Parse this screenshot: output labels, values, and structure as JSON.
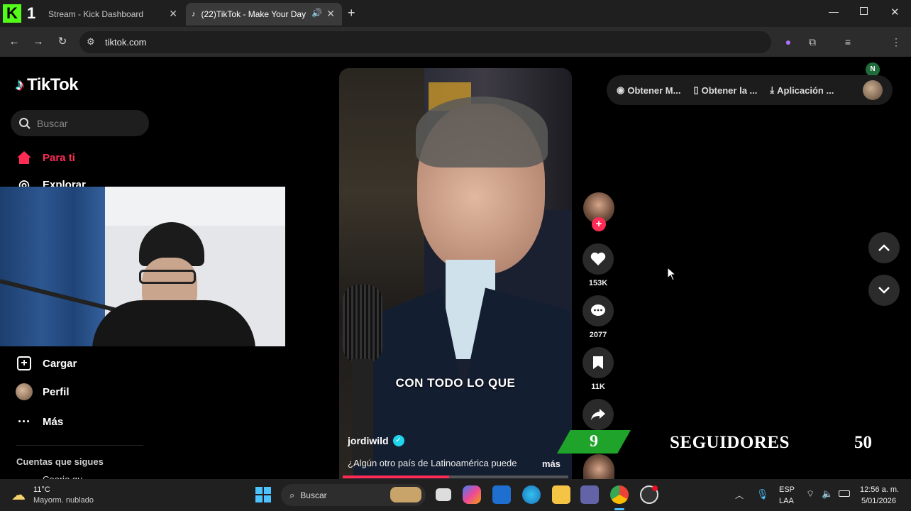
{
  "browser": {
    "tabs": [
      {
        "title": "Stream - Kick Dashboard",
        "active": false
      },
      {
        "title": "(22)TikTok - Make Your Day",
        "active": true
      }
    ],
    "new_tab": "+",
    "url": "tiktok.com",
    "profile_initial": "N",
    "stream_badge": "1",
    "kick_letter": "K"
  },
  "sidebar": {
    "logo_text": "TikTok",
    "search_placeholder": "Buscar",
    "items": [
      {
        "label": "Para ti",
        "icon": "home-icon"
      },
      {
        "label": "Explorar",
        "icon": "compass-icon"
      },
      {
        "label": "Cargar",
        "icon": "upload-icon"
      },
      {
        "label": "Perfil",
        "icon": "avatar-icon"
      },
      {
        "label": "Más",
        "icon": "more-icon"
      }
    ],
    "following_heading": "Cuentas que sigues",
    "following_partial": "Ceorio gu"
  },
  "video": {
    "caption_overlay": "CON TODO LO QUE",
    "author": "jordiwild",
    "description": "¿Algún otro país de Latinoamérica puede",
    "more": "más",
    "likes": "153K",
    "comments": "2077",
    "saves": "11K"
  },
  "topbar": {
    "buttons": [
      "Obtener M...",
      "Obtener la ...",
      "Aplicación ..."
    ]
  },
  "overlay": {
    "followers_current": "9",
    "followers_label": "SEGUIDORES",
    "followers_goal": "50"
  },
  "taskbar": {
    "temp": "11°C",
    "weather": "Mayorm. nublado",
    "search": "Buscar",
    "lang1": "ESP",
    "lang2": "LAA",
    "time": "12:56 a. m.",
    "date": "5/01/2026"
  },
  "colors": {
    "tiktok_red": "#fe2c55",
    "kick_green": "#53fc18",
    "follower_green": "#1fa32a"
  }
}
